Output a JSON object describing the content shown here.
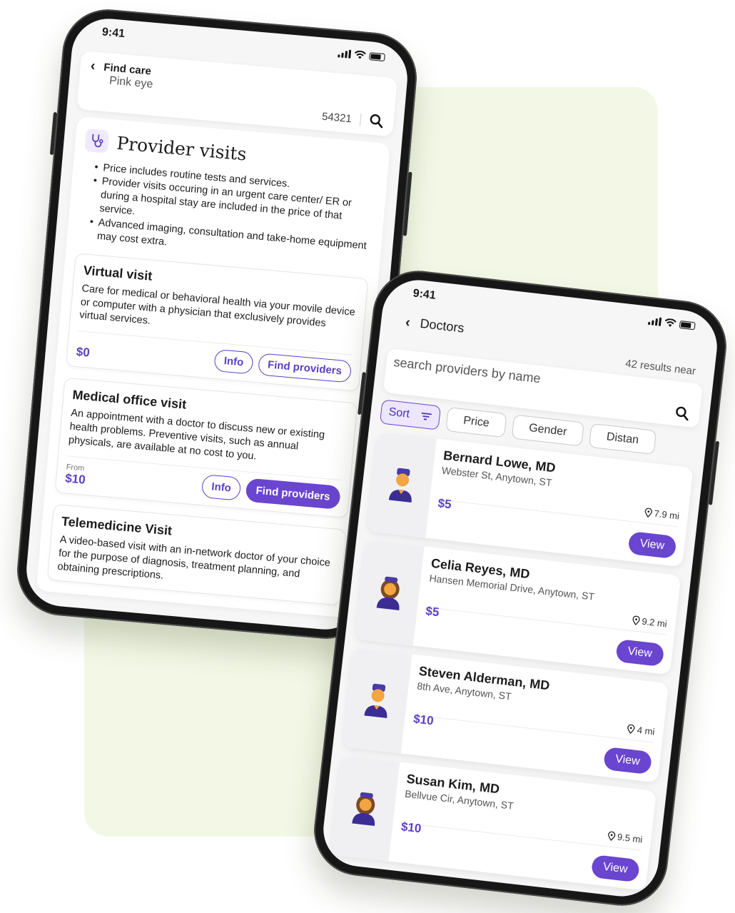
{
  "phone_find_care": {
    "status": {
      "time": "9:41"
    },
    "header": {
      "title": "Find care",
      "subtitle": "Pink eye",
      "zip": "54321"
    },
    "section": {
      "title": "Provider visits",
      "bullets": [
        "Price includes routine tests and services.",
        "Provider visits occuring in an urgent care center/ ER or during a hospital stay are included in the price of that service.",
        "Advanced imaging, consultation and take-home equipment may cost extra."
      ]
    },
    "visits": [
      {
        "title": "Virtual visit",
        "description": "Care for medical or behavioral health via your movile device or computer with a physician that exclusively provides virtual services.",
        "price_prefix": "",
        "price": "$0",
        "info_label": "Info",
        "find_label": "Find providers"
      },
      {
        "title": "Medical office visit",
        "description": "An appointment with a doctor to discuss new or existing health problems. Preventive visits, such as annual physicals, are available at no cost to you.",
        "price_prefix": "From",
        "price": "$10",
        "info_label": "Info",
        "find_label": "Find providers"
      },
      {
        "title": "Telemedicine Visit",
        "description": "A video-based visit with an in-network doctor of your choice for the purpose of diagnosis, treatment planning, and obtaining prescriptions."
      }
    ]
  },
  "phone_doctors": {
    "status": {
      "time": "9:41"
    },
    "header": {
      "title": "Doctors",
      "results": "42 results near"
    },
    "search": {
      "placeholder": "search providers by name"
    },
    "filters": {
      "sort": "Sort",
      "price": "Price",
      "gender": "Gender",
      "distance": "Distan"
    },
    "doctors": [
      {
        "name": "Bernard Lowe, MD",
        "address": "Webster St, Anytown, ST",
        "distance": "7.9 mi",
        "price": "$5",
        "view": "View",
        "avatar": "male-doctor-icon"
      },
      {
        "name": "Celia Reyes, MD",
        "address": "Hansen Memorial Drive, Anytown, ST",
        "distance": "9.2 mi",
        "price": "$5",
        "view": "View",
        "avatar": "female-doctor-icon"
      },
      {
        "name": "Steven Alderman, MD",
        "address": "8th Ave, Anytown, ST",
        "distance": "4 mi",
        "price": "$10",
        "view": "View",
        "avatar": "male-doctor-icon"
      },
      {
        "name": "Susan Kim, MD",
        "address": "Bellvue Cir, Anytown, ST",
        "distance": "9.5 mi",
        "price": "$10",
        "view": "View",
        "avatar": "female-doctor-icon"
      }
    ]
  },
  "colors": {
    "accent": "#6a45cf",
    "backdrop": "#f3f8e6",
    "price": "#5b3fc4"
  }
}
